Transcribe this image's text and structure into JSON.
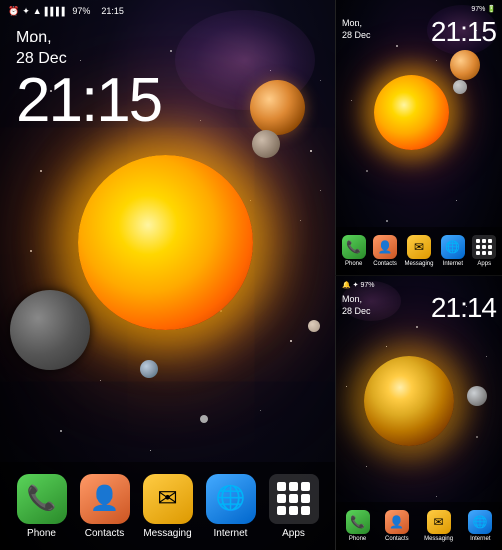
{
  "left": {
    "status": {
      "alarm": "⏰",
      "bluetooth": "🔵",
      "wifi": "▲",
      "signal": "▌▌▌▌",
      "battery": "97%",
      "time": "21:15"
    },
    "date": "Mon,\n28 Dec",
    "clock": "21:15",
    "dock": [
      {
        "id": "phone",
        "label": "Phone",
        "emoji": "📞",
        "colorClass": "icon-phone"
      },
      {
        "id": "contacts",
        "label": "Contacts",
        "emoji": "👤",
        "colorClass": "icon-contacts"
      },
      {
        "id": "messaging",
        "label": "Messaging",
        "emoji": "✉",
        "colorClass": "icon-messaging"
      },
      {
        "id": "internet",
        "label": "Internet",
        "emoji": "🌐",
        "colorClass": "icon-internet"
      },
      {
        "id": "apps",
        "label": "Apps",
        "emoji": "",
        "colorClass": "icon-apps"
      }
    ]
  },
  "right_top": {
    "date": "Mon,\n28 Dec",
    "clock": "21:15",
    "dock": [
      {
        "id": "phone",
        "label": "Phone",
        "emoji": "📞",
        "colorClass": "icon-phone"
      },
      {
        "id": "contacts",
        "label": "Contacts",
        "emoji": "👤",
        "colorClass": "icon-contacts"
      },
      {
        "id": "messaging",
        "label": "Messaging",
        "emoji": "✉",
        "colorClass": "icon-messaging"
      },
      {
        "id": "internet",
        "label": "Internet",
        "emoji": "🌐",
        "colorClass": "icon-internet"
      },
      {
        "id": "apps",
        "label": "Apps",
        "emoji": "",
        "colorClass": "icon-apps"
      }
    ]
  },
  "right_bottom": {
    "date": "Mon,\n28 Dec",
    "clock": "21:14",
    "dock": [
      {
        "id": "phone",
        "label": "Phone",
        "emoji": "📞",
        "colorClass": "icon-phone"
      },
      {
        "id": "contacts",
        "label": "Contacts",
        "emoji": "👤",
        "colorClass": "icon-contacts"
      },
      {
        "id": "messaging",
        "label": "Messaging",
        "emoji": "✉",
        "colorClass": "icon-messaging"
      },
      {
        "id": "internet",
        "label": "Internet",
        "emoji": "🌐",
        "colorClass": "icon-internet"
      }
    ]
  },
  "colors": {
    "star_white": "#ffffff",
    "sun_glow": "#ffd700",
    "bg_dark": "#000000"
  }
}
